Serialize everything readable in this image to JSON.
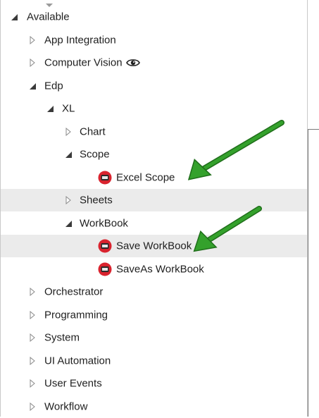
{
  "tree": {
    "available": "Available",
    "app_integration": "App Integration",
    "computer_vision": "Computer Vision",
    "edp": "Edp",
    "xl": "XL",
    "chart": "Chart",
    "scope": "Scope",
    "excel_scope": "Excel Scope",
    "sheets": "Sheets",
    "workbook": "WorkBook",
    "save_workbook": "Save WorkBook",
    "saveas_workbook": "SaveAs WorkBook",
    "orchestrator": "Orchestrator",
    "programming": "Programming",
    "system": "System",
    "ui_automation": "UI Automation",
    "user_events": "User Events",
    "workflow": "Workflow"
  },
  "colors": {
    "highlight": "#ebebeb",
    "arrow": "#2e8b26",
    "activity_icon": "#d9232e"
  },
  "icons": {
    "expanded": "triangle-down-right",
    "collapsed": "triangle-right-outline",
    "activity": "excel-activity-icon",
    "vision": "eye-icon"
  }
}
